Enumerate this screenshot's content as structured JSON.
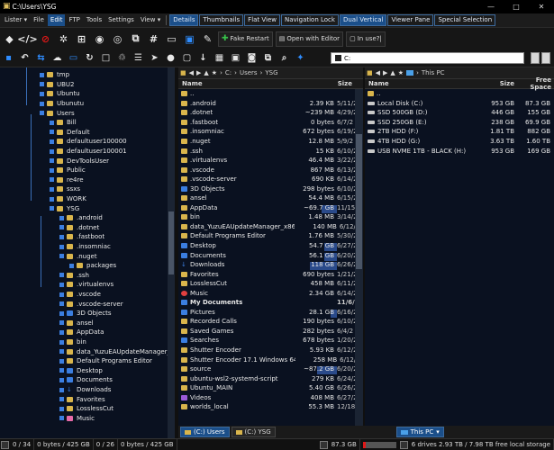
{
  "window": {
    "title": "C:\\Users\\YSG",
    "controls": [
      "—",
      "□",
      "✕"
    ]
  },
  "menubar": {
    "items": [
      {
        "label": "Lister",
        "arrow": "▾",
        "active": false
      },
      {
        "label": "File",
        "active": false
      },
      {
        "label": "Edit",
        "active": true
      },
      {
        "label": "FTP",
        "active": false
      },
      {
        "label": "Tools",
        "active": false
      },
      {
        "label": "Settings",
        "active": false
      },
      {
        "label": "View",
        "arrow": "▾",
        "active": false
      }
    ],
    "tabs": [
      {
        "label": "Details",
        "selected": true
      },
      {
        "label": "Thumbnails",
        "selected": false
      },
      {
        "label": "Flat View",
        "selected": false
      },
      {
        "label": "Navigation Lock",
        "selected": false
      },
      {
        "label": "Dual Vertical",
        "selected": true
      },
      {
        "label": "Viewer Pane",
        "selected": false
      },
      {
        "label": "Special Selection",
        "selected": false
      }
    ]
  },
  "toolbar1": {
    "icons": [
      "git-icon",
      "code-icon",
      "no-entry-icon",
      "ubuntu-icon",
      "windows-icon",
      "steam-icon",
      "gamepad-icon",
      "copy-icon",
      "hash-icon",
      "terminal-icon",
      "box-icon",
      "edit-icon"
    ],
    "fake_restart": "Fake Restart",
    "open_with_editor": "Open with Editor",
    "in_use": "In use?|"
  },
  "toolbar2": {
    "icons": [
      "save-icon",
      "back-icon",
      "link-icon",
      "cloud-icon",
      "monitor-icon",
      "refresh-icon",
      "square-icon",
      "recycle-icon",
      "list-icon",
      "cursor-icon",
      "user-icon",
      "window-icon",
      "download-icon",
      "grid-icon",
      "photo-icon",
      "camera-icon",
      "copy-icon",
      "search-icon",
      "ai-icon"
    ],
    "path_value": "C:"
  },
  "tree": {
    "items": [
      {
        "label": "tmp",
        "indent": 0,
        "y": 0
      },
      {
        "label": "UBU2",
        "indent": 0,
        "y": 1
      },
      {
        "label": "Ubuntu",
        "indent": 0,
        "y": 2
      },
      {
        "label": "Ubunutu",
        "indent": 0,
        "y": 3
      },
      {
        "label": "Users",
        "indent": 0,
        "y": 4
      },
      {
        "label": "Bill",
        "indent": 1,
        "y": 5
      },
      {
        "label": "Default",
        "indent": 1,
        "y": 6
      },
      {
        "label": "defaultuser100000",
        "indent": 1,
        "y": 7
      },
      {
        "label": "defaultuser100001",
        "indent": 1,
        "y": 8
      },
      {
        "label": "DevToolsUser",
        "indent": 1,
        "y": 9
      },
      {
        "label": "Public",
        "indent": 1,
        "y": 10
      },
      {
        "label": "re4re",
        "indent": 1,
        "y": 11
      },
      {
        "label": "ssxs",
        "indent": 1,
        "y": 12
      },
      {
        "label": "WORK",
        "indent": 1,
        "y": 13
      },
      {
        "label": "YSG",
        "indent": 1,
        "y": 14
      },
      {
        "label": ".android",
        "indent": 2,
        "y": 15
      },
      {
        "label": ".dotnet",
        "indent": 2,
        "y": 16
      },
      {
        "label": ".fastboot",
        "indent": 2,
        "y": 17
      },
      {
        "label": ".insomniac",
        "indent": 2,
        "y": 18
      },
      {
        "label": ".nuget",
        "indent": 2,
        "y": 19
      },
      {
        "label": "packages",
        "indent": 3,
        "y": 20
      },
      {
        "label": ".ssh",
        "indent": 2,
        "y": 21
      },
      {
        "label": ".virtualenvs",
        "indent": 2,
        "y": 22
      },
      {
        "label": ".vscode",
        "indent": 2,
        "y": 23
      },
      {
        "label": ".vscode-server",
        "indent": 2,
        "y": 24
      },
      {
        "label": "3D Objects",
        "indent": 2,
        "y": 25,
        "icon": "blue"
      },
      {
        "label": "ansel",
        "indent": 2,
        "y": 26
      },
      {
        "label": "AppData",
        "indent": 2,
        "y": 27
      },
      {
        "label": "bin",
        "indent": 2,
        "y": 28
      },
      {
        "label": "data_YuzuEAUpdateManager_x86_64",
        "indent": 2,
        "y": 29
      },
      {
        "label": "Default Programs Editor",
        "indent": 2,
        "y": 30
      },
      {
        "label": "Desktop",
        "indent": 2,
        "y": 31,
        "icon": "blue"
      },
      {
        "label": "Documents",
        "indent": 2,
        "y": 32,
        "icon": "blue"
      },
      {
        "label": "Downloads",
        "indent": 2,
        "y": 33,
        "icon": "down"
      },
      {
        "label": "Favorites",
        "indent": 2,
        "y": 34
      },
      {
        "label": "LosslessCut",
        "indent": 2,
        "y": 35
      },
      {
        "label": "Music",
        "indent": 2,
        "y": 36,
        "icon": "pink"
      }
    ]
  },
  "left_pane": {
    "path": [
      "C:",
      "Users",
      "YSG"
    ],
    "columns": {
      "name": "Name",
      "size": "Size",
      "date": "Date"
    },
    "rows": [
      {
        "name": "..",
        "size": "",
        "date": "",
        "icon": "folder"
      },
      {
        "name": ".android",
        "size": "2.39 KB",
        "date": "5/11/2",
        "icon": "folder"
      },
      {
        "name": ".dotnet",
        "size": "~239 MB",
        "date": "4/29/2",
        "icon": "folder"
      },
      {
        "name": ".fastboot",
        "size": "0 bytes",
        "date": "6/7/2",
        "icon": "folder"
      },
      {
        "name": ".insomniac",
        "size": "672 bytes",
        "date": "6/19/2",
        "icon": "folder"
      },
      {
        "name": ".nuget",
        "size": "12.8 MB",
        "date": "5/9/2",
        "icon": "folder"
      },
      {
        "name": ".ssh",
        "size": "15 KB",
        "date": "6/10/2",
        "icon": "folder"
      },
      {
        "name": ".virtualenvs",
        "size": "46.4 MB",
        "date": "3/22/2",
        "icon": "folder"
      },
      {
        "name": ".vscode",
        "size": "867 MB",
        "date": "6/13/2",
        "icon": "folder"
      },
      {
        "name": ".vscode-server",
        "size": "690 KB",
        "date": "6/14/2",
        "icon": "folder"
      },
      {
        "name": "3D Objects",
        "size": "298 bytes",
        "date": "6/10/2",
        "icon": "blue"
      },
      {
        "name": "ansel",
        "size": "54.4 MB",
        "date": "6/15/2",
        "icon": "folder"
      },
      {
        "name": "AppData",
        "size": "~69.7 GB",
        "date": "11/15/2",
        "icon": "folder",
        "bar": 0.55
      },
      {
        "name": "bin",
        "size": "1.48 MB",
        "date": "3/14/2",
        "icon": "folder"
      },
      {
        "name": "data_YuzuEAUpdateManager_x86_64",
        "size": "140 MB",
        "date": "6/12/2",
        "icon": "folder"
      },
      {
        "name": "Default Programs Editor",
        "size": "1.76 MB",
        "date": "5/30/2",
        "icon": "folder"
      },
      {
        "name": "Desktop",
        "size": "54.7 GB",
        "date": "6/27/2",
        "icon": "blue",
        "bar": 0.45
      },
      {
        "name": "Documents",
        "size": "56.1 GB",
        "date": "6/20/2",
        "icon": "blue",
        "bar": 0.47
      },
      {
        "name": "Downloads",
        "size": "118 GB",
        "date": "6/26/2",
        "icon": "dl",
        "bar": 1.0
      },
      {
        "name": "Favorites",
        "size": "690 bytes",
        "date": "1/21/2",
        "icon": "folder"
      },
      {
        "name": "LosslessCut",
        "size": "458 MB",
        "date": "6/11/2",
        "icon": "folder"
      },
      {
        "name": "Music",
        "size": "2.34 GB",
        "date": "6/14/2",
        "icon": "red"
      },
      {
        "name": "My Documents",
        "size": "",
        "date": "11/6/2",
        "icon": "blue",
        "bold": true
      },
      {
        "name": "Pictures",
        "size": "28.1 GB",
        "date": "6/16/2",
        "icon": "blue",
        "bar": 0.24
      },
      {
        "name": "Recorded Calls",
        "size": "190 bytes",
        "date": "6/10/2",
        "icon": "folder"
      },
      {
        "name": "Saved Games",
        "size": "282 bytes",
        "date": "6/4/2",
        "icon": "folder"
      },
      {
        "name": "Searches",
        "size": "678 bytes",
        "date": "1/20/2",
        "icon": "blue"
      },
      {
        "name": "Shutter Encoder",
        "size": "5.93 KB",
        "date": "6/12/2",
        "icon": "folder"
      },
      {
        "name": "Shutter Encoder 17.1 Windows 64bits",
        "size": "258 MB",
        "date": "6/12/2",
        "icon": "folder"
      },
      {
        "name": "source",
        "size": "~87.2 GB",
        "date": "6/20/2",
        "icon": "folder",
        "bar": 0.74
      },
      {
        "name": "ubuntu-wsl2-systemd-script",
        "size": "279 KB",
        "date": "6/24/2",
        "icon": "folder"
      },
      {
        "name": "Ubuntu_MAIN",
        "size": "5.40 GB",
        "date": "6/26/2",
        "icon": "folder"
      },
      {
        "name": "Videos",
        "size": "408 MB",
        "date": "6/27/2",
        "icon": "purple"
      },
      {
        "name": "worlds_local",
        "size": "55.3 MB",
        "date": "12/18/2",
        "icon": "folder"
      }
    ]
  },
  "right_pane": {
    "path": "This PC",
    "columns": {
      "name": "Name",
      "size": "Size",
      "free": "Free Space"
    },
    "rows": [
      {
        "name": "..",
        "size": "",
        "free": ""
      },
      {
        "name": "Local Disk (C:)",
        "size": "953 GB",
        "free": "87.3 GB"
      },
      {
        "name": "SSD 500GB (D:)",
        "size": "446 GB",
        "free": "155 GB"
      },
      {
        "name": "SSD 250GB (E:)",
        "size": "238 GB",
        "free": "69.9 GB"
      },
      {
        "name": "2TB HDD (F:)",
        "size": "1.81 TB",
        "free": "882 GB"
      },
      {
        "name": "4TB HDD (G:)",
        "size": "3.63 TB",
        "free": "1.60 TB"
      },
      {
        "name": "USB NVME 1TB - BLACK (H:)",
        "size": "953 GB",
        "free": "169 GB"
      }
    ]
  },
  "tabs": [
    {
      "label": "(C:) Users",
      "active": true,
      "icon": "folder"
    },
    {
      "label": "(C:) YSG",
      "active": false,
      "icon": "folder"
    },
    {
      "label": "This PC",
      "active": true,
      "icon": "pc"
    }
  ],
  "status": {
    "left_count": "0 / 34",
    "left_size": "0 bytes / 425 GB",
    "left_count2": "0 / 26",
    "right_size": "0 bytes / 425 GB",
    "free": "87.3 GB",
    "free_fraction": 0.09,
    "drives": "6 drives 2.93 TB / 7.98 TB free local storage"
  }
}
